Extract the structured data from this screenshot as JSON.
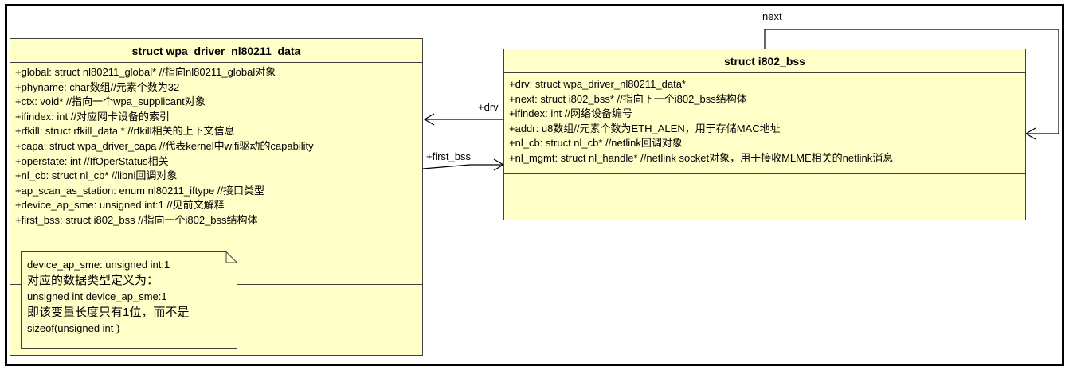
{
  "left_class": {
    "title": "struct wpa_driver_nl80211_data",
    "attributes": [
      "+global: struct nl80211_global*  //指向nl80211_global对象",
      "+phyname: char数组//元素个数为32",
      "+ctx: void* //指向一个wpa_supplicant对象",
      "+ifindex: int //对应网卡设备的索引",
      "+rfkill: struct rfkill_data * //rfkill相关的上下文信息",
      "+capa: struct wpa_driver_capa //代表kernel中wifi驱动的capability",
      "+operstate: int //IfOperStatus相关",
      "+nl_cb: struct nl_cb*  //libnl回调对象",
      "+ap_scan_as_station: enum nl80211_iftype //接口类型",
      "+device_ap_sme: unsigned int:1 //见前文解释",
      "+first_bss: struct i802_bss  //指向一个i802_bss结构体"
    ]
  },
  "note": {
    "lines": [
      "device_ap_sme: unsigned int:1",
      "对应的数据类型定义为：",
      "unsigned int device_ap_sme:1",
      "即该变量长度只有1位，而不是",
      "sizeof(unsigned int )"
    ]
  },
  "right_class": {
    "title": "struct i802_bss",
    "attributes": [
      "+drv: struct wpa_driver_nl80211_data*",
      "+next: struct i802_bss* //指向下一个i802_bss结构体",
      "+ifindex: int  //网络设备编号",
      "+addr: u8数组//元素个数为ETH_ALEN，用于存储MAC地址",
      "+nl_cb: struct nl_cb* //netlink回调对象",
      "+nl_mgmt: struct nl_handle* //netlink socket对象，用于接收MLME相关的netlink消息"
    ]
  },
  "connectors": {
    "drv_label": "+drv",
    "first_bss_label": "+first_bss",
    "next_label": "next"
  }
}
